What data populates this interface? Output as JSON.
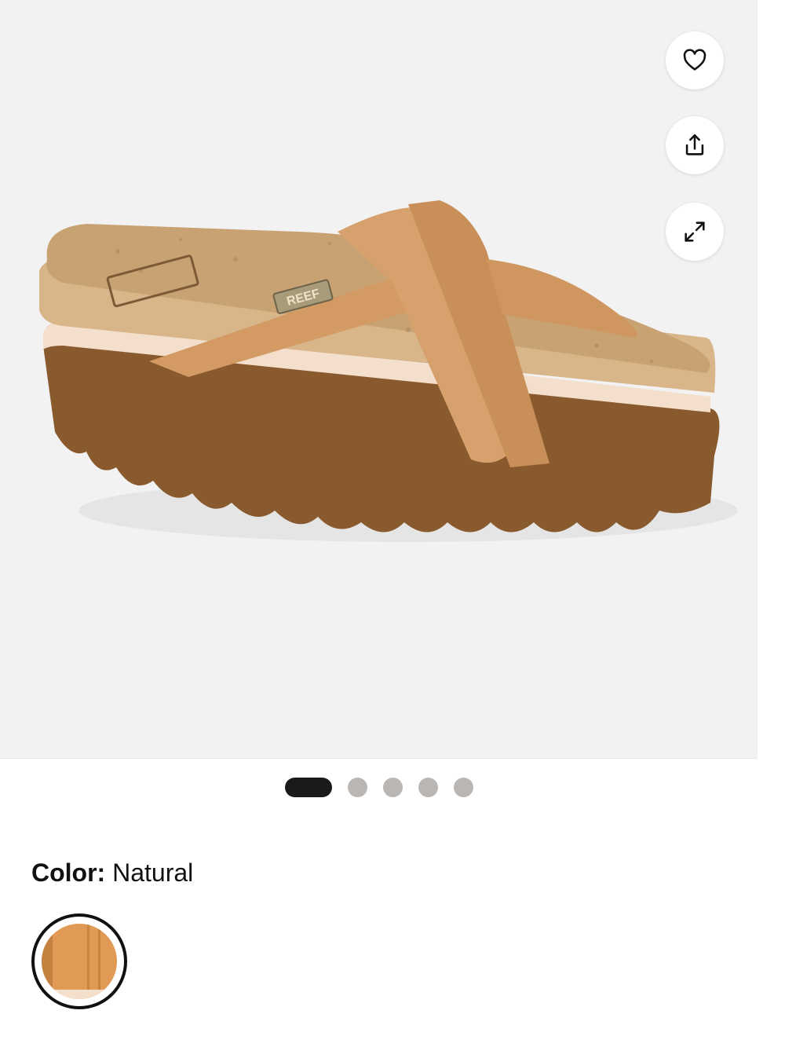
{
  "gallery": {
    "product_image_alt": "Reef cork-footbed criss-cross slide sandal",
    "brand_tag_text": "REEF",
    "dots_count": 5,
    "active_index": 0,
    "actions": {
      "favorite_icon": "heart-icon",
      "share_icon": "share-icon",
      "expand_icon": "expand-icon"
    }
  },
  "color": {
    "label": "Color:",
    "value": "Natural",
    "swatch_color": "#e09a55"
  },
  "colors": {
    "strap": "#d7a16d",
    "cork": "#c9a273",
    "sole": "#8a5a2f",
    "background": "#f2f2f2"
  }
}
